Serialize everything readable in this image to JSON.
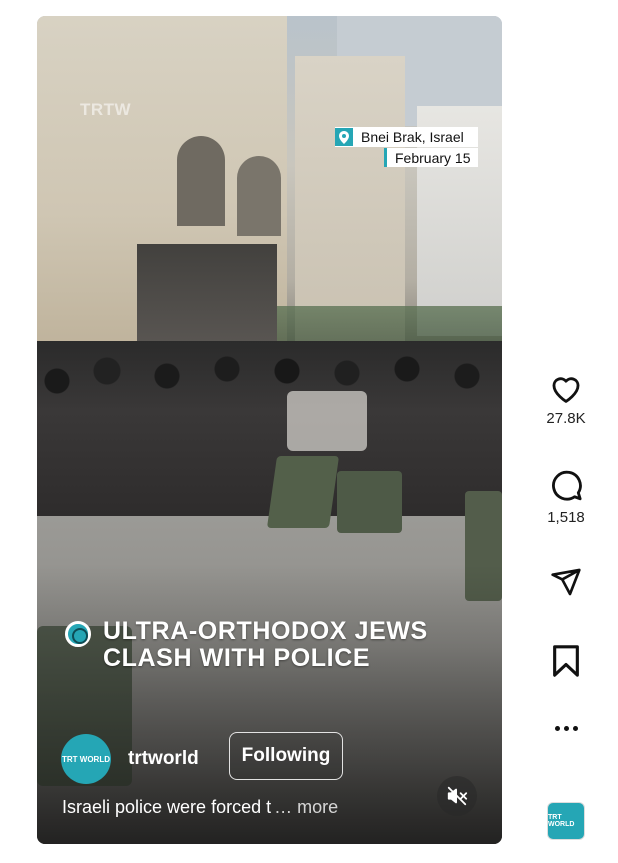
{
  "reel": {
    "watermark": "TRTW",
    "location": {
      "place": "Bnei Brak, Israel",
      "date": "February 15",
      "icon": "location-pin-icon"
    },
    "headline": "ULTRA-ORTHODOX JEWS CLASH WITH POLICE",
    "author": {
      "username": "trtworld",
      "avatar_text": "TRT WORLD"
    },
    "follow_label": "Following",
    "caption": {
      "text": "Israeli police were forced t",
      "more": "… more"
    },
    "mute_icon": "muted-speaker-icon"
  },
  "actions": {
    "like": {
      "icon": "heart-icon",
      "count": "27.8K"
    },
    "comment": {
      "icon": "comment-bubble-icon",
      "count": "1,518"
    },
    "share": {
      "icon": "paper-plane-icon"
    },
    "save": {
      "icon": "bookmark-icon"
    },
    "more": {
      "icon": "more-dots-icon"
    }
  },
  "audio": {
    "thumb_text": "TRT WORLD"
  },
  "colors": {
    "accent": "#25a6b5",
    "text_dark": "#222222",
    "text_light": "#ffffff"
  }
}
